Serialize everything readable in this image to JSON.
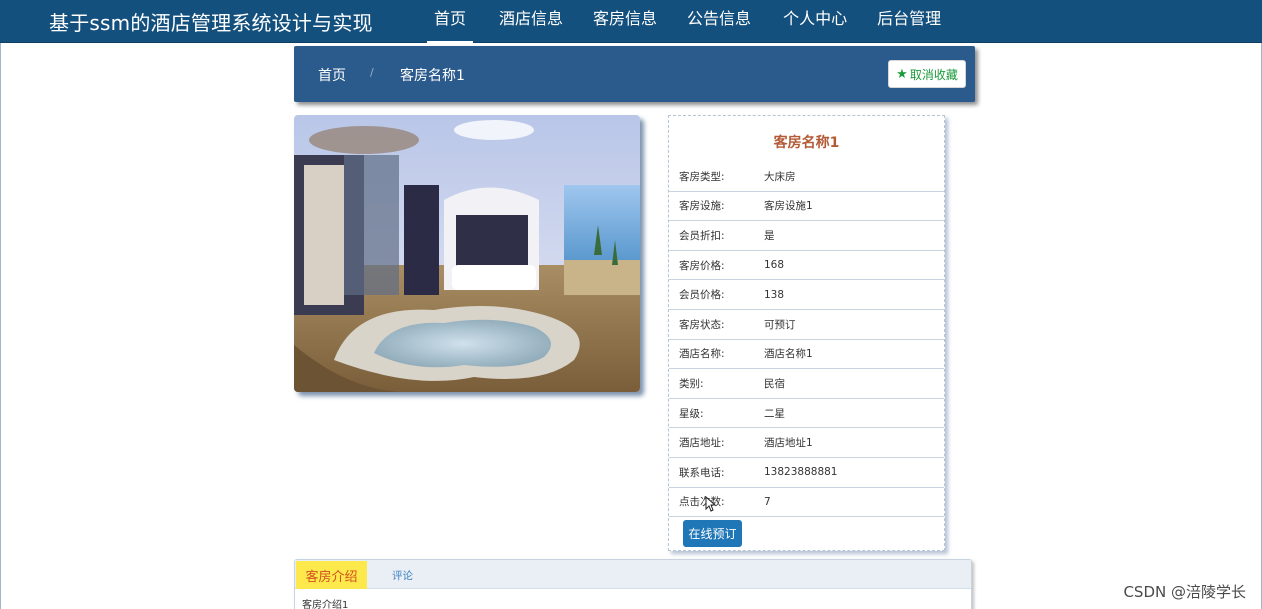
{
  "header": {
    "site_title": "基于ssm的酒店管理系统设计与实现",
    "nav": [
      {
        "label": "首页",
        "active": true
      },
      {
        "label": "酒店信息",
        "active": false
      },
      {
        "label": "客房信息",
        "active": false
      },
      {
        "label": "公告信息",
        "active": false
      },
      {
        "label": "个人中心",
        "active": false
      },
      {
        "label": "后台管理",
        "active": false
      }
    ],
    "bg_color": "#14507d"
  },
  "breadcrumb": {
    "home": "首页",
    "separator": "/",
    "current": "客房名称1",
    "favorite_button": "取消收藏",
    "favorite_icon": "star-icon"
  },
  "room": {
    "image_alt": "room-photo",
    "title": "客房名称1",
    "fields": [
      {
        "label": "客房类型:",
        "value": "大床房"
      },
      {
        "label": "客房设施:",
        "value": "客房设施1"
      },
      {
        "label": "会员折扣:",
        "value": "是"
      },
      {
        "label": "客房价格:",
        "value": "168"
      },
      {
        "label": "会员价格:",
        "value": "138"
      },
      {
        "label": "客房状态:",
        "value": "可预订"
      },
      {
        "label": "酒店名称:",
        "value": "酒店名称1"
      },
      {
        "label": "类别:",
        "value": "民宿"
      },
      {
        "label": "星级:",
        "value": "二星"
      },
      {
        "label": "酒店地址:",
        "value": "酒店地址1"
      },
      {
        "label": "联系电话:",
        "value": "13823888881"
      },
      {
        "label": "点击次数:",
        "value": "7"
      }
    ],
    "book_button": "在线预订"
  },
  "tabs": {
    "intro_label": "客房介绍",
    "comment_label": "评论",
    "intro_content": "客房介绍1"
  },
  "watermark": "CSDN @涪陵学长"
}
